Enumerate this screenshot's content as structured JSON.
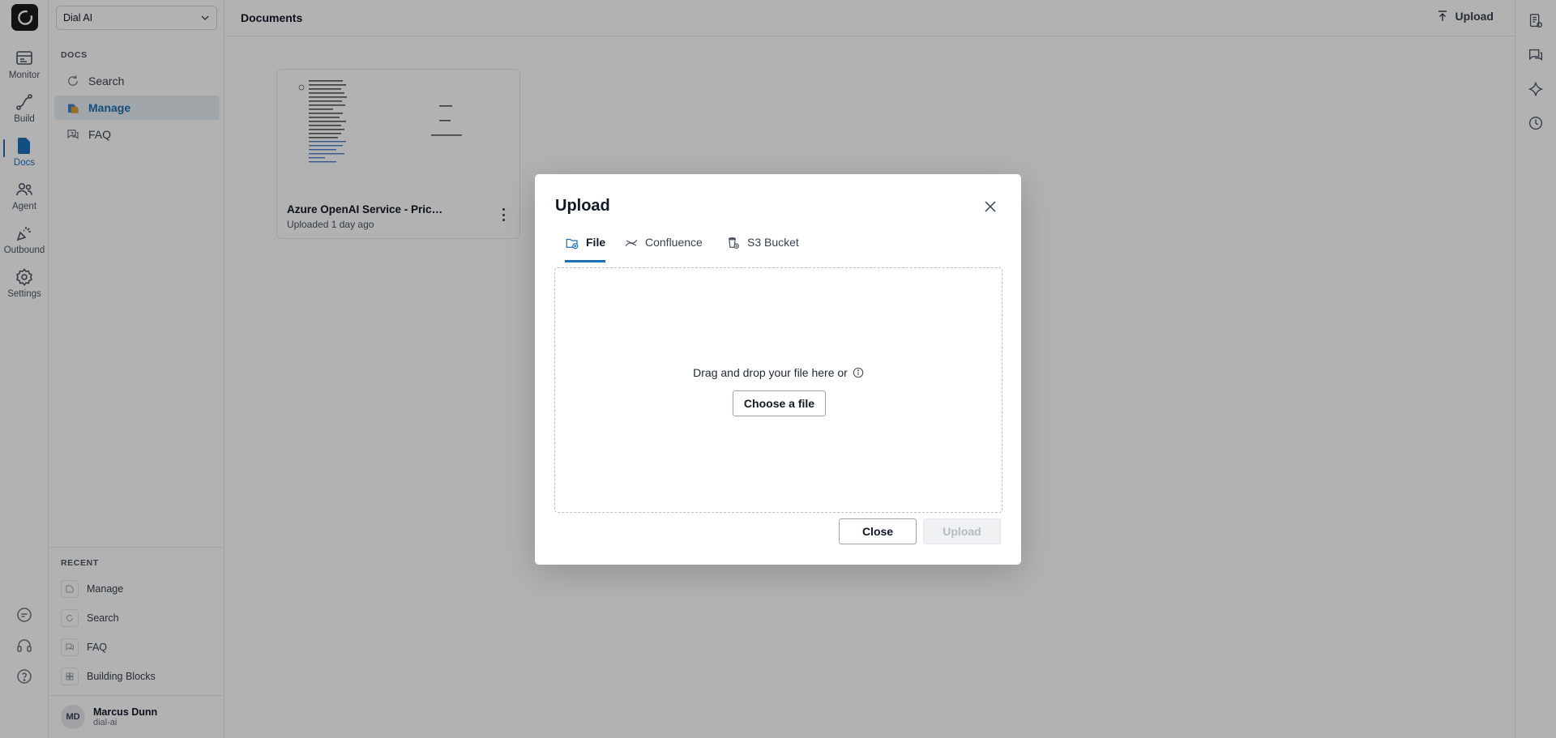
{
  "app": {
    "logo_icon": "dial-logo-icon",
    "rail": [
      {
        "label": "Monitor",
        "icon": "monitor-icon"
      },
      {
        "label": "Build",
        "icon": "build-icon"
      },
      {
        "label": "Docs",
        "icon": "docs-icon",
        "active": true
      },
      {
        "label": "Agent",
        "icon": "agent-icon"
      },
      {
        "label": "Outbound",
        "icon": "outbound-icon"
      },
      {
        "label": "Settings",
        "icon": "settings-icon"
      }
    ],
    "rail_bottom_icons": [
      "chat-icon",
      "headset-icon",
      "help-icon"
    ],
    "accent_color": "#1d6fb8"
  },
  "sidebar": {
    "workspace": "Dial AI",
    "section_title": "DOCS",
    "items": [
      {
        "label": "Search",
        "icon": "search-refresh-icon"
      },
      {
        "label": "Manage",
        "icon": "manage-icon",
        "active": true
      },
      {
        "label": "FAQ",
        "icon": "faq-icon"
      }
    ],
    "recent_title": "RECENT",
    "recent": [
      {
        "label": "Manage",
        "icon": "manage-icon"
      },
      {
        "label": "Search",
        "icon": "search-icon"
      },
      {
        "label": "FAQ",
        "icon": "faq-icon"
      },
      {
        "label": "Building Blocks",
        "icon": "blocks-icon"
      }
    ],
    "user": {
      "initials": "MD",
      "name": "Marcus Dunn",
      "org": "dial-ai"
    }
  },
  "header": {
    "title": "Documents",
    "upload_label": "Upload"
  },
  "right_rail_icons": [
    "notes-icon",
    "chat-bubble-icon",
    "sparkle-icon",
    "history-icon"
  ],
  "documents": [
    {
      "title": "Azure OpenAI Service - Pric…",
      "subtitle": "Uploaded 1 day ago"
    }
  ],
  "modal": {
    "title": "Upload",
    "tabs": [
      {
        "label": "File",
        "icon": "file-add-icon",
        "active": true
      },
      {
        "label": "Confluence",
        "icon": "confluence-icon"
      },
      {
        "label": "S3 Bucket",
        "icon": "s3-bucket-icon"
      }
    ],
    "drop_text": "Drag and drop your file here or",
    "choose_label": "Choose a file",
    "close_label": "Close",
    "upload_label": "Upload"
  }
}
